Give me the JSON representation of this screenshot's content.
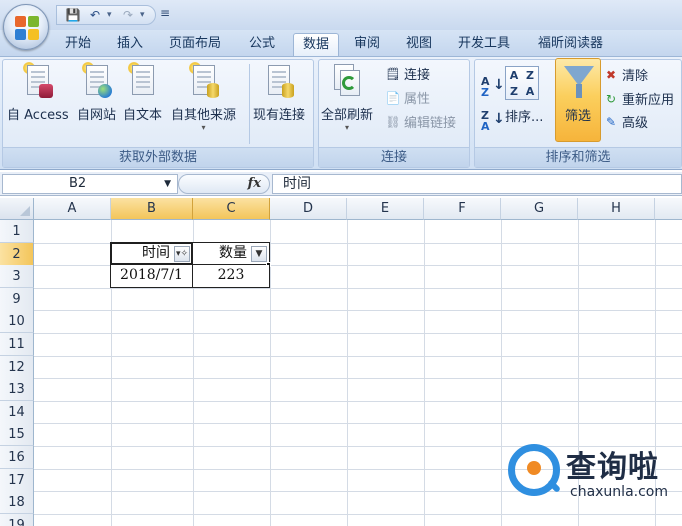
{
  "window": {
    "menu_tabs": [
      {
        "label": "开始",
        "active": false
      },
      {
        "label": "插入",
        "active": false
      },
      {
        "label": "页面布局",
        "active": false
      },
      {
        "label": "公式",
        "active": false
      },
      {
        "label": "数据",
        "active": true
      },
      {
        "label": "审阅",
        "active": false
      },
      {
        "label": "视图",
        "active": false
      },
      {
        "label": "开发工具",
        "active": false
      },
      {
        "label": "福昕阅读器",
        "active": false
      }
    ]
  },
  "ribbon": {
    "external": {
      "group_label": "获取外部数据",
      "access": "自 Access",
      "web": "自网站",
      "text": "自文本",
      "other": "自其他来源",
      "existing": "现有连接"
    },
    "connections": {
      "group_label": "连接",
      "refresh_all": "全部刷新",
      "connections": "连接",
      "properties": "属性",
      "edit_links": "编辑链接"
    },
    "sort_filter": {
      "group_label": "排序和筛选",
      "sort": "排序...",
      "filter": "筛选",
      "clear": "清除",
      "reapply": "重新应用",
      "advanced": "高级"
    }
  },
  "formula_bar": {
    "name_box": "B2",
    "fx": "fx",
    "content": "时间"
  },
  "sheet": {
    "columns": [
      "A",
      "B",
      "C",
      "D",
      "E",
      "F",
      "G",
      "H"
    ],
    "rows": [
      "1",
      "2",
      "3",
      "9",
      "10",
      "11",
      "12",
      "13",
      "14",
      "15",
      "16",
      "17",
      "18",
      "19"
    ],
    "selected_column": "B",
    "selected_row": "2",
    "b2": "时间",
    "c2": "数量",
    "b3": "2018/7/1",
    "c3": "223"
  },
  "watermark": {
    "cn": "查询啦",
    "en": "chaxunla.com"
  },
  "colors": {
    "accent": "#f6b43b",
    "ribbon": "#dce8f7"
  }
}
